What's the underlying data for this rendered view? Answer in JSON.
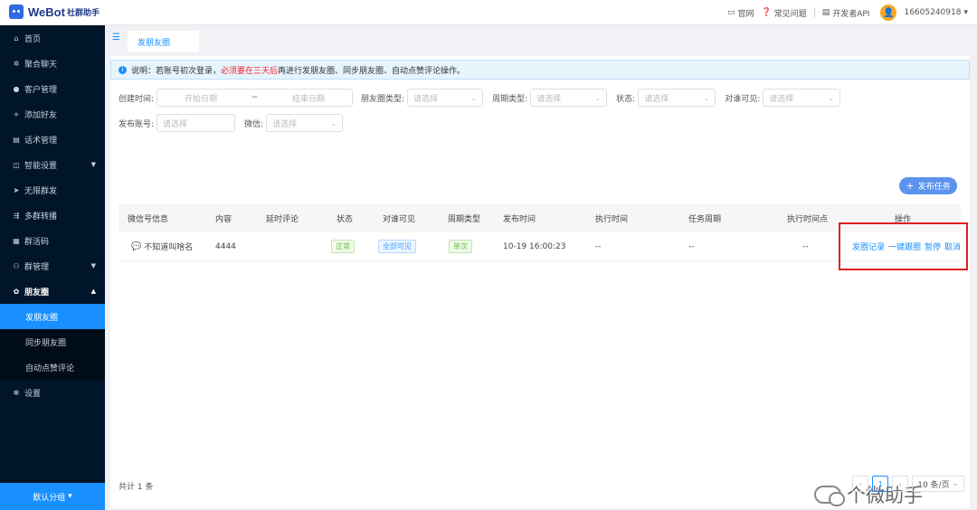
{
  "app": {
    "name": "WeBot",
    "subtitle": "社群助手"
  },
  "topnav": {
    "official_site": "官网",
    "faq": "常见问题",
    "dev_api": "开发者API",
    "phone": "16605240918"
  },
  "sidebar": {
    "items": [
      {
        "label": "首页",
        "icon": "home-icon"
      },
      {
        "label": "聚合聊天",
        "icon": "chat-icon"
      },
      {
        "label": "客户管理",
        "icon": "user-icon"
      },
      {
        "label": "添加好友",
        "icon": "add-user-icon"
      },
      {
        "label": "话术管理",
        "icon": "doc-icon"
      },
      {
        "label": "智能设置",
        "icon": "settings-icon"
      },
      {
        "label": "无限群发",
        "icon": "send-icon"
      },
      {
        "label": "多群转播",
        "icon": "broadcast-icon"
      },
      {
        "label": "群活码",
        "icon": "qrcode-icon"
      },
      {
        "label": "群管理",
        "icon": "group-icon"
      },
      {
        "label": "朋友圈",
        "icon": "moments-icon"
      }
    ],
    "subitems": [
      {
        "label": "发朋友圈"
      },
      {
        "label": "同步朋友圈"
      },
      {
        "label": "自动点赞评论"
      }
    ],
    "settings": "设置",
    "group_button": "默认分组"
  },
  "tabs": [
    {
      "label": "发朋友圈"
    }
  ],
  "notice": {
    "prefix": "说明：若账号初次登录，",
    "highlight": "必须要在三天后",
    "suffix": "再进行发朋友圈、同步朋友圈、自动点赞评论操作。"
  },
  "filters": {
    "create_time_label": "创建时间:",
    "start_placeholder": "开始日期",
    "range_sep": "~",
    "end_placeholder": "结束日期",
    "moments_type_label": "朋友圈类型:",
    "period_type_label": "周期类型:",
    "status_label": "状态:",
    "visibility_label": "对谁可见:",
    "account_label": "发布账号:",
    "wechat_label": "微信:",
    "select_placeholder": "请选择"
  },
  "publish_button": "发布任务",
  "table": {
    "headers": [
      "微信号信息",
      "内容",
      "延时评论",
      "状态",
      "对谁可见",
      "周期类型",
      "发布时间",
      "执行时间",
      "任务周期",
      "执行时间点",
      "操作"
    ],
    "rows": [
      {
        "wechat": "不知道叫啥名",
        "content": "4444",
        "delay_comment": "",
        "status": "正常",
        "visibility": "全部可见",
        "period": "单次",
        "publish_time": "10-19 16:00:23",
        "exec_time": "--",
        "task_period": "--",
        "exec_point": "--",
        "actions": [
          "发圈记录",
          "一键跟圈",
          "暂停",
          "取消"
        ]
      }
    ]
  },
  "footer": {
    "total": "共计 1 条",
    "current_page": "1",
    "page_size": "10 条/页"
  },
  "watermark": "个微助手"
}
